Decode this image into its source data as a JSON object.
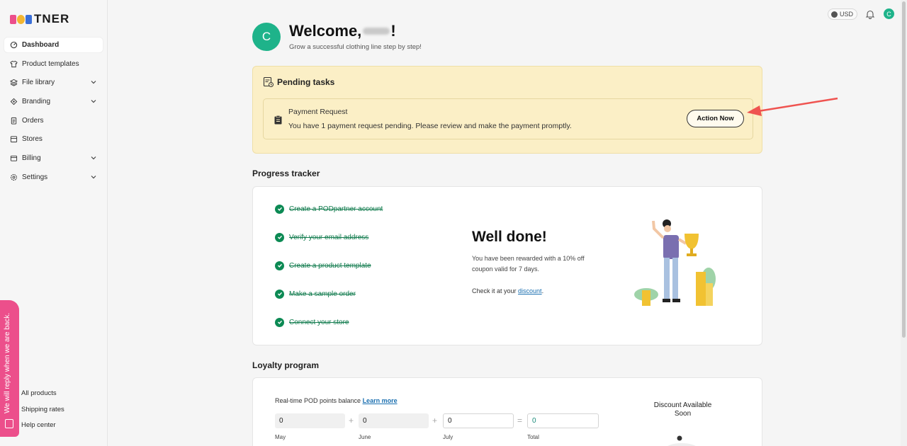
{
  "brand": {
    "logo_text": "TNER",
    "accent": "#1eb38a"
  },
  "sidebar": {
    "items": [
      {
        "label": "Dashboard",
        "icon": "dashboard-icon"
      },
      {
        "label": "Product templates",
        "icon": "shirt-icon"
      },
      {
        "label": "File library",
        "icon": "layers-icon"
      },
      {
        "label": "Branding",
        "icon": "tag-icon"
      },
      {
        "label": "Orders",
        "icon": "clipboard-icon"
      },
      {
        "label": "Stores",
        "icon": "store-icon"
      },
      {
        "label": "Billing",
        "icon": "wallet-icon"
      },
      {
        "label": "Settings",
        "icon": "gear-icon"
      }
    ],
    "bottom": [
      "All products",
      "Shipping rates",
      "Help center"
    ]
  },
  "chat": {
    "label": "We will reply when we are back."
  },
  "header": {
    "currency": "USD",
    "avatar_letter": "C"
  },
  "welcome": {
    "avatar_letter": "C",
    "greeting": "Welcome,",
    "exclaim": "!",
    "subtitle": "Grow a successful clothing line step by step!"
  },
  "pending": {
    "title": "Pending tasks",
    "task_title": "Payment Request",
    "task_desc": "You have 1 payment request pending. Please review and make the payment promptly.",
    "action_label": "Action Now"
  },
  "progress": {
    "title": "Progress tracker",
    "steps": [
      "Create a PODpartner account",
      "Verify your email address",
      "Create a product template",
      "Make a sample order",
      "Connect your store"
    ],
    "done_title": "Well done!",
    "reward": "You have been rewarded with a 10% off coupon valid for 7 days.",
    "check_prefix": "Check it at your ",
    "check_link": "discount",
    "check_suffix": "."
  },
  "loyalty": {
    "title": "Loyalty program",
    "note": "Real-time POD points balance ",
    "learn_more": "Learn more",
    "fields": [
      {
        "value": "0",
        "label": "May"
      },
      {
        "value": "0",
        "label": "June"
      },
      {
        "value": "0",
        "label": "July"
      },
      {
        "value": "0",
        "label": "Total"
      }
    ],
    "ops": [
      "+",
      "+",
      "="
    ],
    "discount": "Discount Available Soon"
  }
}
